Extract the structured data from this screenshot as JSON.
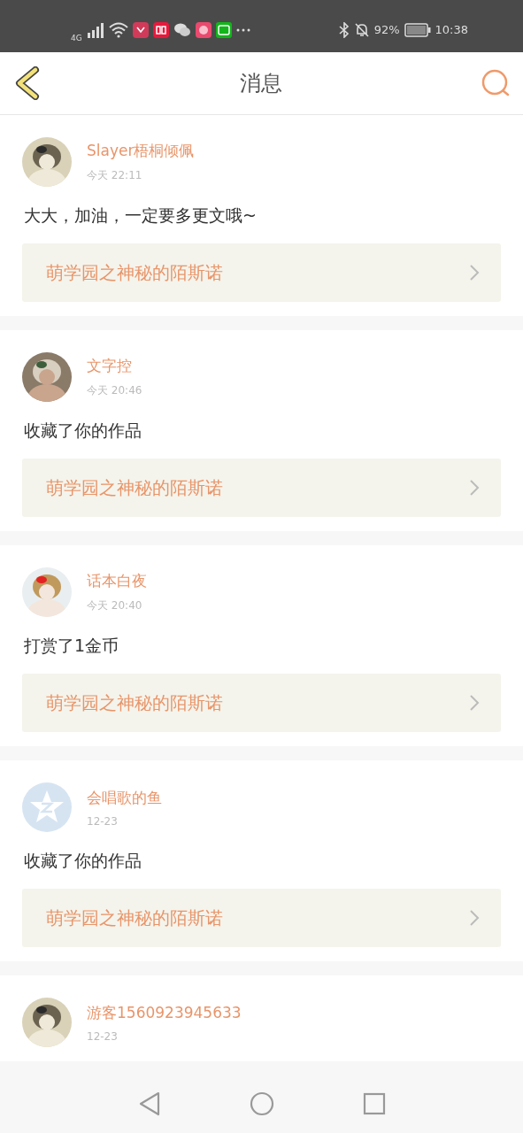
{
  "status_bar": {
    "network": "4G",
    "battery": "92%",
    "time": "10:38"
  },
  "header": {
    "title": "消息"
  },
  "messages": [
    {
      "name": "Slayer梧桐倾佩",
      "time": "今天 22:11",
      "text": "大大，加油，一定要多更文哦~",
      "link": "萌学园之神秘的陌斯诺"
    },
    {
      "name": "文字控",
      "time": "今天 20:46",
      "text": "收藏了你的作品",
      "link": "萌学园之神秘的陌斯诺"
    },
    {
      "name": "话本白夜",
      "time": "今天 20:40",
      "text": "打赏了1金币",
      "link": "萌学园之神秘的陌斯诺"
    },
    {
      "avatar": {
        "kind": "default"
      },
      "name": "会唱歌的鱼",
      "time": "12-23",
      "text": "收藏了你的作品",
      "link": "萌学园之神秘的陌斯诺"
    },
    {
      "name": "游客1560923945633",
      "time": "12-23"
    }
  ]
}
